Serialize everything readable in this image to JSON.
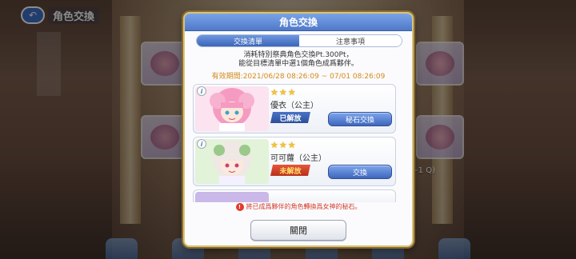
{
  "game": {
    "top_title": "角色交換",
    "right_tag": "(+1 Q)"
  },
  "dialog": {
    "title": "角色交換",
    "tabs": [
      {
        "label": "交換清單",
        "active": true
      },
      {
        "label": "注意事項",
        "active": false
      }
    ],
    "description_line1": "消耗特別祭典角色交換Pt.300Pt，",
    "description_line2": "能從目標清單中選1個角色成爲夥伴。",
    "period_label": "有效期間:",
    "period_value": "2021/06/28 08:26:09 ~ 07/01 08:26:09",
    "characters": [
      {
        "name": "優衣（公主）",
        "rarity": 3,
        "status": "已解放",
        "status_type": "unlocked",
        "action": "秘石交換",
        "info": "i"
      },
      {
        "name": "可可蘿（公主）",
        "rarity": 3,
        "status": "未解放",
        "status_type": "locked",
        "action": "交換",
        "info": "i"
      }
    ],
    "notice_icon": "!",
    "notice_text": "將已成爲夥伴的角色轉換爲女神的秘石。",
    "close_label": "關閉"
  },
  "colors": {
    "header_blue": "#4f79c9",
    "accent_gold": "#d9c37a",
    "period_orange": "#d38a1c",
    "notice_red": "#d33b2a",
    "unlocked_blue": "#2b4f9a",
    "locked_red": "#b8301a"
  }
}
